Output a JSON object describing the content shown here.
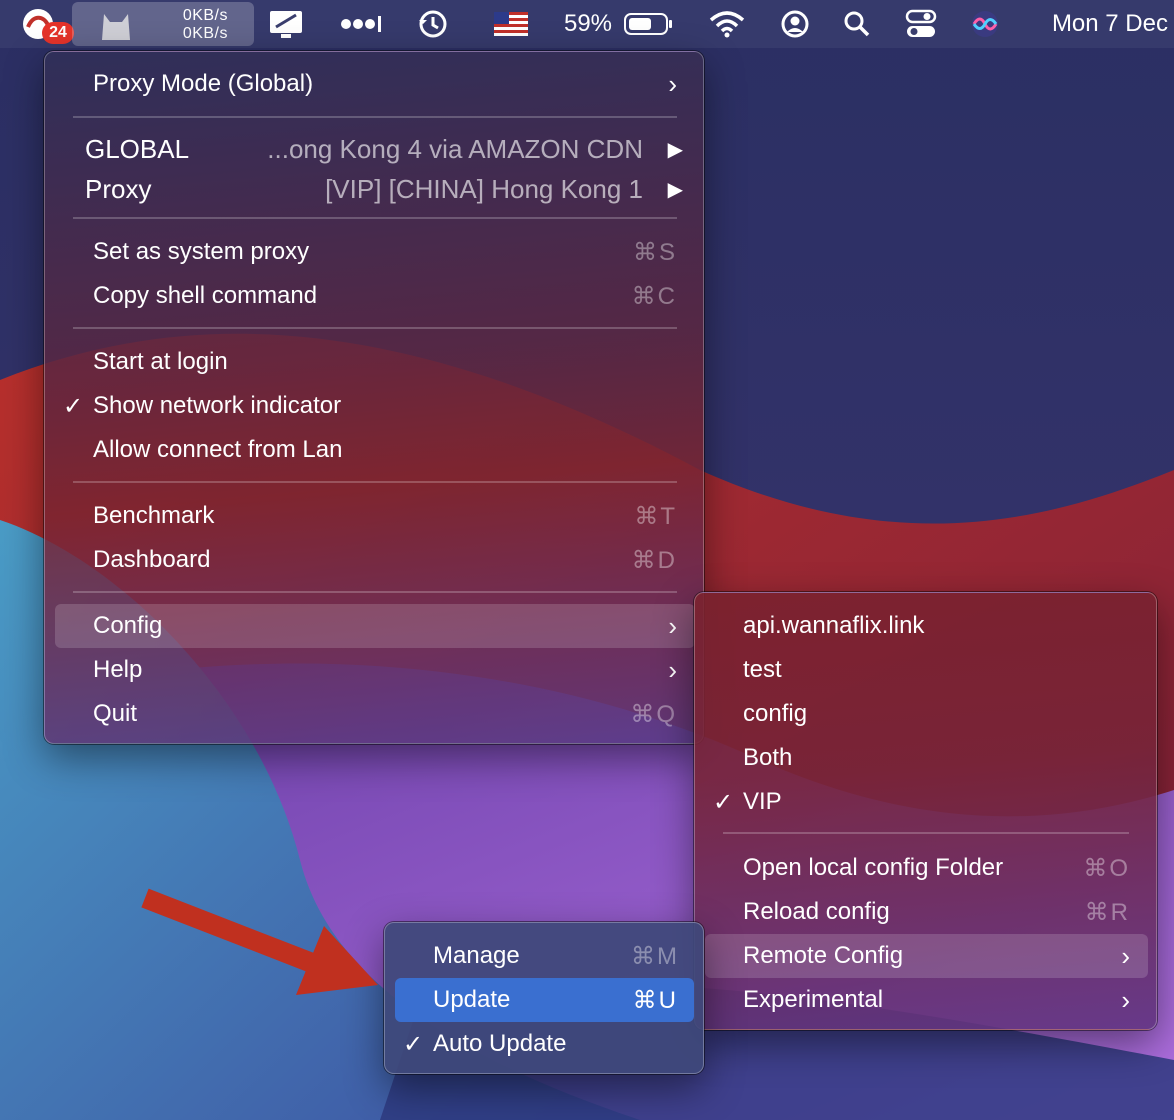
{
  "menubar": {
    "notification_badge": "24",
    "upload_speed": "0KB/s",
    "download_speed": "0KB/s",
    "battery_percent": "59%",
    "clock": "Mon 7 Dec",
    "icons": [
      "app-notification-icon",
      "clashx-cat-icon",
      "display-icon",
      "dots-icon",
      "time-machine-icon",
      "us-flag-icon",
      "battery-icon",
      "wifi-icon",
      "user-icon",
      "search-icon",
      "control-center-icon",
      "siri-icon"
    ]
  },
  "main_menu": {
    "proxy_mode": "Proxy Mode (Global)",
    "global_label": "GLOBAL",
    "global_value": "...ong Kong 4 via AMAZON CDN",
    "proxy_label": "Proxy",
    "proxy_value": "[VIP] [CHINA] Hong Kong 1",
    "set_system_proxy": "Set as system proxy",
    "set_system_proxy_shortcut": "⌘S",
    "copy_shell": "Copy shell command",
    "copy_shell_shortcut": "⌘C",
    "start_login": "Start at login",
    "show_network": "Show network indicator",
    "allow_lan": "Allow connect from Lan",
    "benchmark": "Benchmark",
    "benchmark_shortcut": "⌘T",
    "dashboard": "Dashboard",
    "dashboard_shortcut": "⌘D",
    "config": "Config",
    "help": "Help",
    "quit": "Quit",
    "quit_shortcut": "⌘Q"
  },
  "config_menu": {
    "items": [
      "api.wannaflix.link",
      "test",
      "config",
      "Both",
      "VIP"
    ],
    "selected": "VIP",
    "open_local": "Open local config Folder",
    "open_local_shortcut": "⌘O",
    "reload": "Reload config",
    "reload_shortcut": "⌘R",
    "remote_config": "Remote Config",
    "experimental": "Experimental"
  },
  "remote_menu": {
    "manage": "Manage",
    "manage_shortcut": "⌘M",
    "update": "Update",
    "update_shortcut": "⌘U",
    "auto_update": "Auto Update"
  },
  "colors": {
    "highlight_blue": "#3a6fd0",
    "badge_red": "#e5332a",
    "arrow_red": "#c0301f"
  }
}
